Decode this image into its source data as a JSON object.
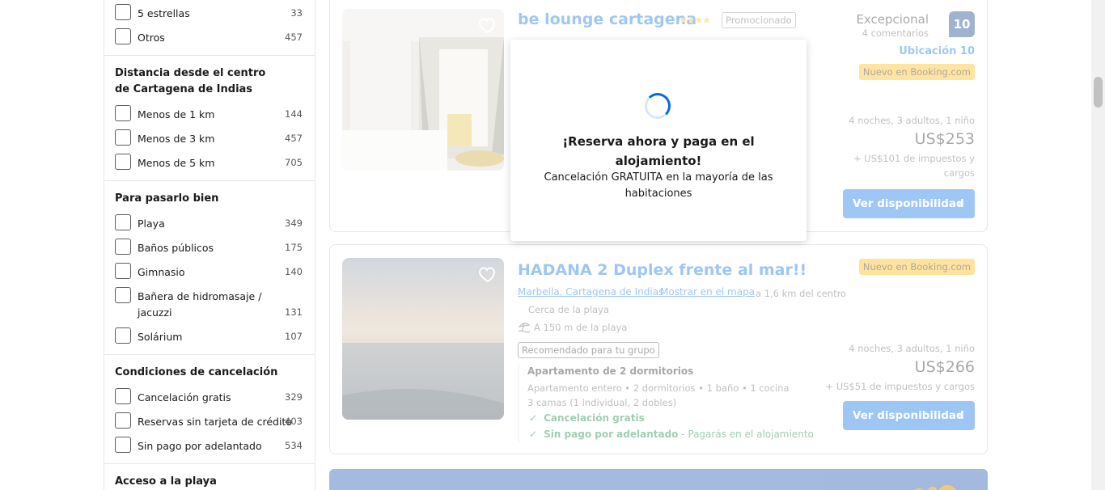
{
  "sidebar": {
    "top_rows": [
      {
        "label": "5 estrellas",
        "count": "33"
      },
      {
        "label": "Otros",
        "count": "457"
      }
    ],
    "distance": {
      "title": "Distancia desde el centro de Cartagena de Indias",
      "rows": [
        {
          "label": "Menos de 1 km",
          "count": "144"
        },
        {
          "label": "Menos de 3 km",
          "count": "457"
        },
        {
          "label": "Menos de 5 km",
          "count": "705"
        }
      ]
    },
    "fun": {
      "title": "Para pasarlo bien",
      "rows": [
        {
          "label": "Playa",
          "count": "349"
        },
        {
          "label": "Baños públicos",
          "count": "175"
        },
        {
          "label": "Gimnasio",
          "count": "140"
        },
        {
          "label": "Bañera de hidromasaje / jacuzzi",
          "count": "131"
        },
        {
          "label": "Solárium",
          "count": "107"
        }
      ]
    },
    "cancel": {
      "title": "Condiciones de cancelación",
      "rows": [
        {
          "label": "Cancelación gratis",
          "count": "329"
        },
        {
          "label": "Reservas sin tarjeta de crédito",
          "count": "403"
        },
        {
          "label": "Sin pago por adelantado",
          "count": "534"
        }
      ]
    },
    "beach": {
      "title": "Acceso a la playa"
    }
  },
  "cards": [
    {
      "name": "be lounge cartagena",
      "stars": "★★★★",
      "promoted": "Promocionado",
      "score_word": "Excepcional",
      "reviews": "4 comentarios",
      "score": "10",
      "location_score": "Ubicación 10",
      "new_badge": "Nuevo en Booking.com",
      "stay": "4 noches, 3 adultos, 1 niño",
      "price": "US$253",
      "taxes_line1": "+ US$101 de impuestos y",
      "taxes_line2": "cargos",
      "button": "Ver disponibilidad"
    },
    {
      "name": "HADANA 2 Duplex frente al mar!!",
      "new_badge": "Nuevo en Booking.com",
      "area_link": "Marbella, Cartagena de Indias",
      "map_link": "Mostrar en el mapa",
      "distance": "a 1,6 km del centro",
      "near_beach": "Cerca de la playa",
      "beach_distance": "A 150 m de la playa",
      "recommended": "Recomendado para tu grupo",
      "room_title": "Apartamento de 2 dormitorios",
      "room_details": "Apartamento entero • 2 dormitorios • 1 baño • 1 cocina",
      "beds": "3 camas (1 individual, 2 dobles)",
      "free_cancel": "Cancelación gratis",
      "no_prepay": "Sin pago por adelantado",
      "no_prepay_note": " - Pagarás en el alojamiento",
      "stay": "4 noches, 3 adultos, 1 niño",
      "price": "US$266",
      "taxes": "+ US$51 de impuestos y cargos",
      "button": "Ver disponibilidad"
    }
  ],
  "modal": {
    "title": "¡Reserva ahora y paga en el alojamiento!",
    "subtitle": "Cancelación GRATUITA en la mayoría de las habitaciones"
  },
  "colors": {
    "brand_blue": "#006ce4",
    "dark_blue": "#003580",
    "star_yellow": "#febb02",
    "green": "#008234"
  }
}
